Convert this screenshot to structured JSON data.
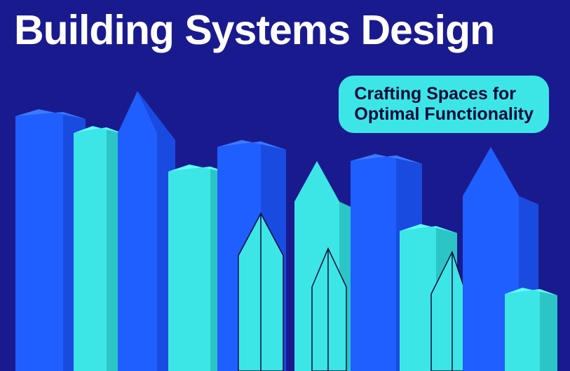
{
  "title": "Building Systems Design",
  "subtitle_line1": "Crafting Spaces for",
  "subtitle_line2": "Optimal Functionality",
  "colors": {
    "background": "#1a1a8f",
    "accent_cyan": "#3de6e6",
    "building_blue": "#1f5fff",
    "building_blue_dark": "#1a4be0",
    "building_cyan": "#3de6e6",
    "building_cyan_dark": "#2bc5c5",
    "outline": "#0a0a3a"
  }
}
